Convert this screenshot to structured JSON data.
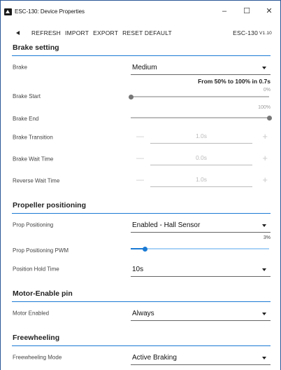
{
  "window": {
    "title": "ESC-130: Device Properties",
    "minimize": "–",
    "maximize": "☐",
    "close": "✕"
  },
  "toolbar": {
    "refresh": "REFRESH",
    "import": "IMPORT",
    "export": "EXPORT",
    "reset": "RESET DEFAULT",
    "device": "ESC-130",
    "version": "V1.10"
  },
  "brake": {
    "section_title": "Brake setting",
    "brake_label": "Brake",
    "brake_value": "Medium",
    "range_summary": "From 50% to 100% in 0.7s",
    "start_label": "Brake Start",
    "start_value_text": "0%",
    "start_value": 0,
    "end_label": "Brake End",
    "end_value_text": "100%",
    "end_value": 100,
    "transition_label": "Brake Transition",
    "transition_value": "1.0s",
    "wait_label": "Brake Wait Time",
    "wait_value": "0.0s",
    "reverse_label": "Reverse Wait Time",
    "reverse_value": "1.0s",
    "minus": "—",
    "plus": "+"
  },
  "prop": {
    "section_title": "Propeller positioning",
    "positioning_label": "Prop Positioning",
    "positioning_value": "Enabled - Hall Sensor",
    "pwm_label": "Prop Positioning PWM",
    "pwm_value_text": "3%",
    "pwm_value": 3,
    "hold_label": "Position Hold Time",
    "hold_value": "10s"
  },
  "motor": {
    "section_title": "Motor-Enable pin",
    "enabled_label": "Motor Enabled",
    "enabled_value": "Always"
  },
  "freewheel": {
    "section_title": "Freewheeling",
    "mode_label": "Freewheeling Mode",
    "mode_value": "Active Braking"
  }
}
